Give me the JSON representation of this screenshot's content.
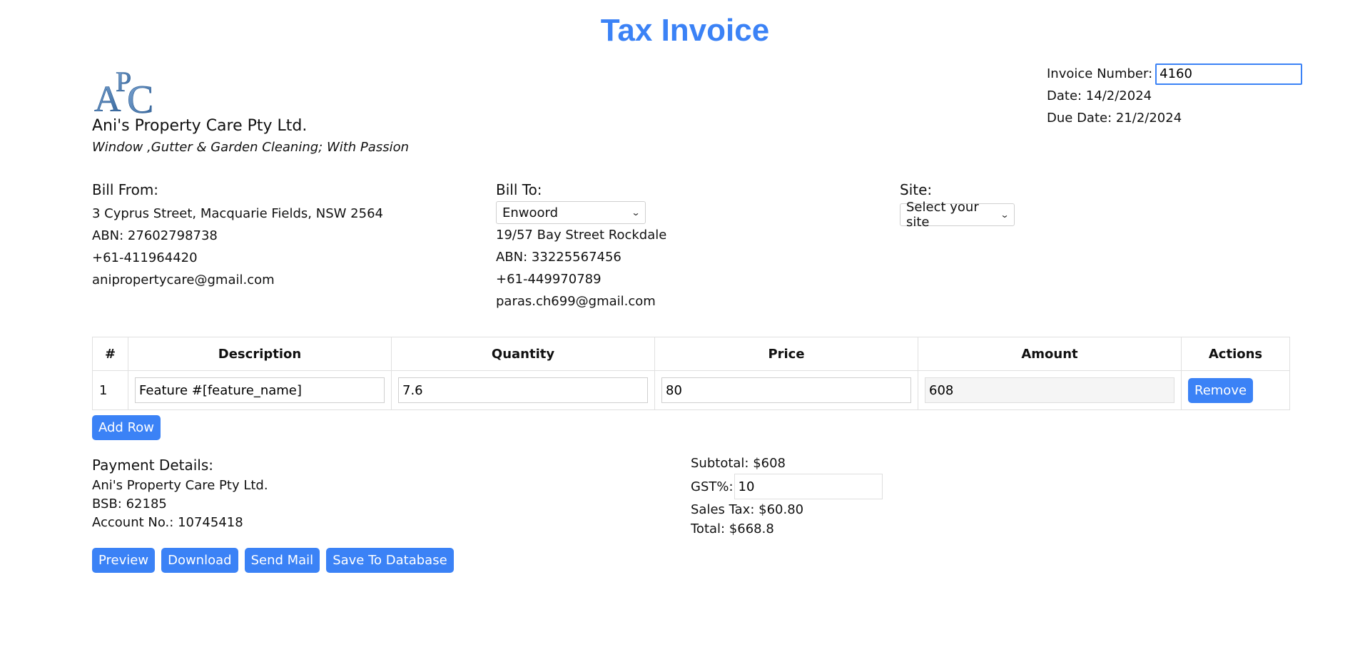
{
  "title": "Tax Invoice",
  "company": {
    "logo_text": "APC",
    "name": "Ani's Property Care Pty Ltd.",
    "tagline": "Window ,Gutter & Garden Cleaning; With Passion"
  },
  "invoice": {
    "number_label": "Invoice Number:",
    "number_value": "4160",
    "date": "Date: 14/2/2024",
    "due_date": "Due Date: 21/2/2024"
  },
  "bill_from": {
    "heading": "Bill From:",
    "address": "3 Cyprus Street, Macquarie Fields, NSW 2564",
    "abn": "ABN: 27602798738",
    "phone": "+61-411964420",
    "email": "anipropertycare@gmail.com"
  },
  "bill_to": {
    "heading": "Bill To:",
    "selected": "Enwoord",
    "address": "19/57 Bay Street Rockdale",
    "abn": "ABN: 33225567456",
    "phone": "+61-449970789",
    "email": "paras.ch699@gmail.com"
  },
  "site": {
    "heading": "Site:",
    "selected": "Select your site"
  },
  "table": {
    "headers": [
      "#",
      "Description",
      "Quantity",
      "Price",
      "Amount",
      "Actions"
    ],
    "rows": [
      {
        "index": "1",
        "description": "Feature #[feature_name]",
        "quantity": "7.6",
        "price": "80",
        "amount": "608",
        "action": "Remove"
      }
    ]
  },
  "add_row_label": "Add Row",
  "payment": {
    "heading": "Payment Details:",
    "account_name": "Ani's Property Care Pty Ltd.",
    "bsb": "BSB: 62185",
    "account_no": "Account No.: 10745418"
  },
  "totals": {
    "subtotal": "Subtotal: $608",
    "gst_label": "GST%:",
    "gst_value": "10",
    "sales_tax": "Sales Tax: $60.80",
    "total": "Total: $668.8"
  },
  "buttons": {
    "preview": "Preview",
    "download": "Download",
    "send_mail": "Send Mail",
    "save": "Save To Database"
  },
  "colors": {
    "accent": "#3b82f6",
    "logo": "#4a7fb5"
  },
  "icons": {
    "select_chevron": "chevron-down-icon"
  }
}
